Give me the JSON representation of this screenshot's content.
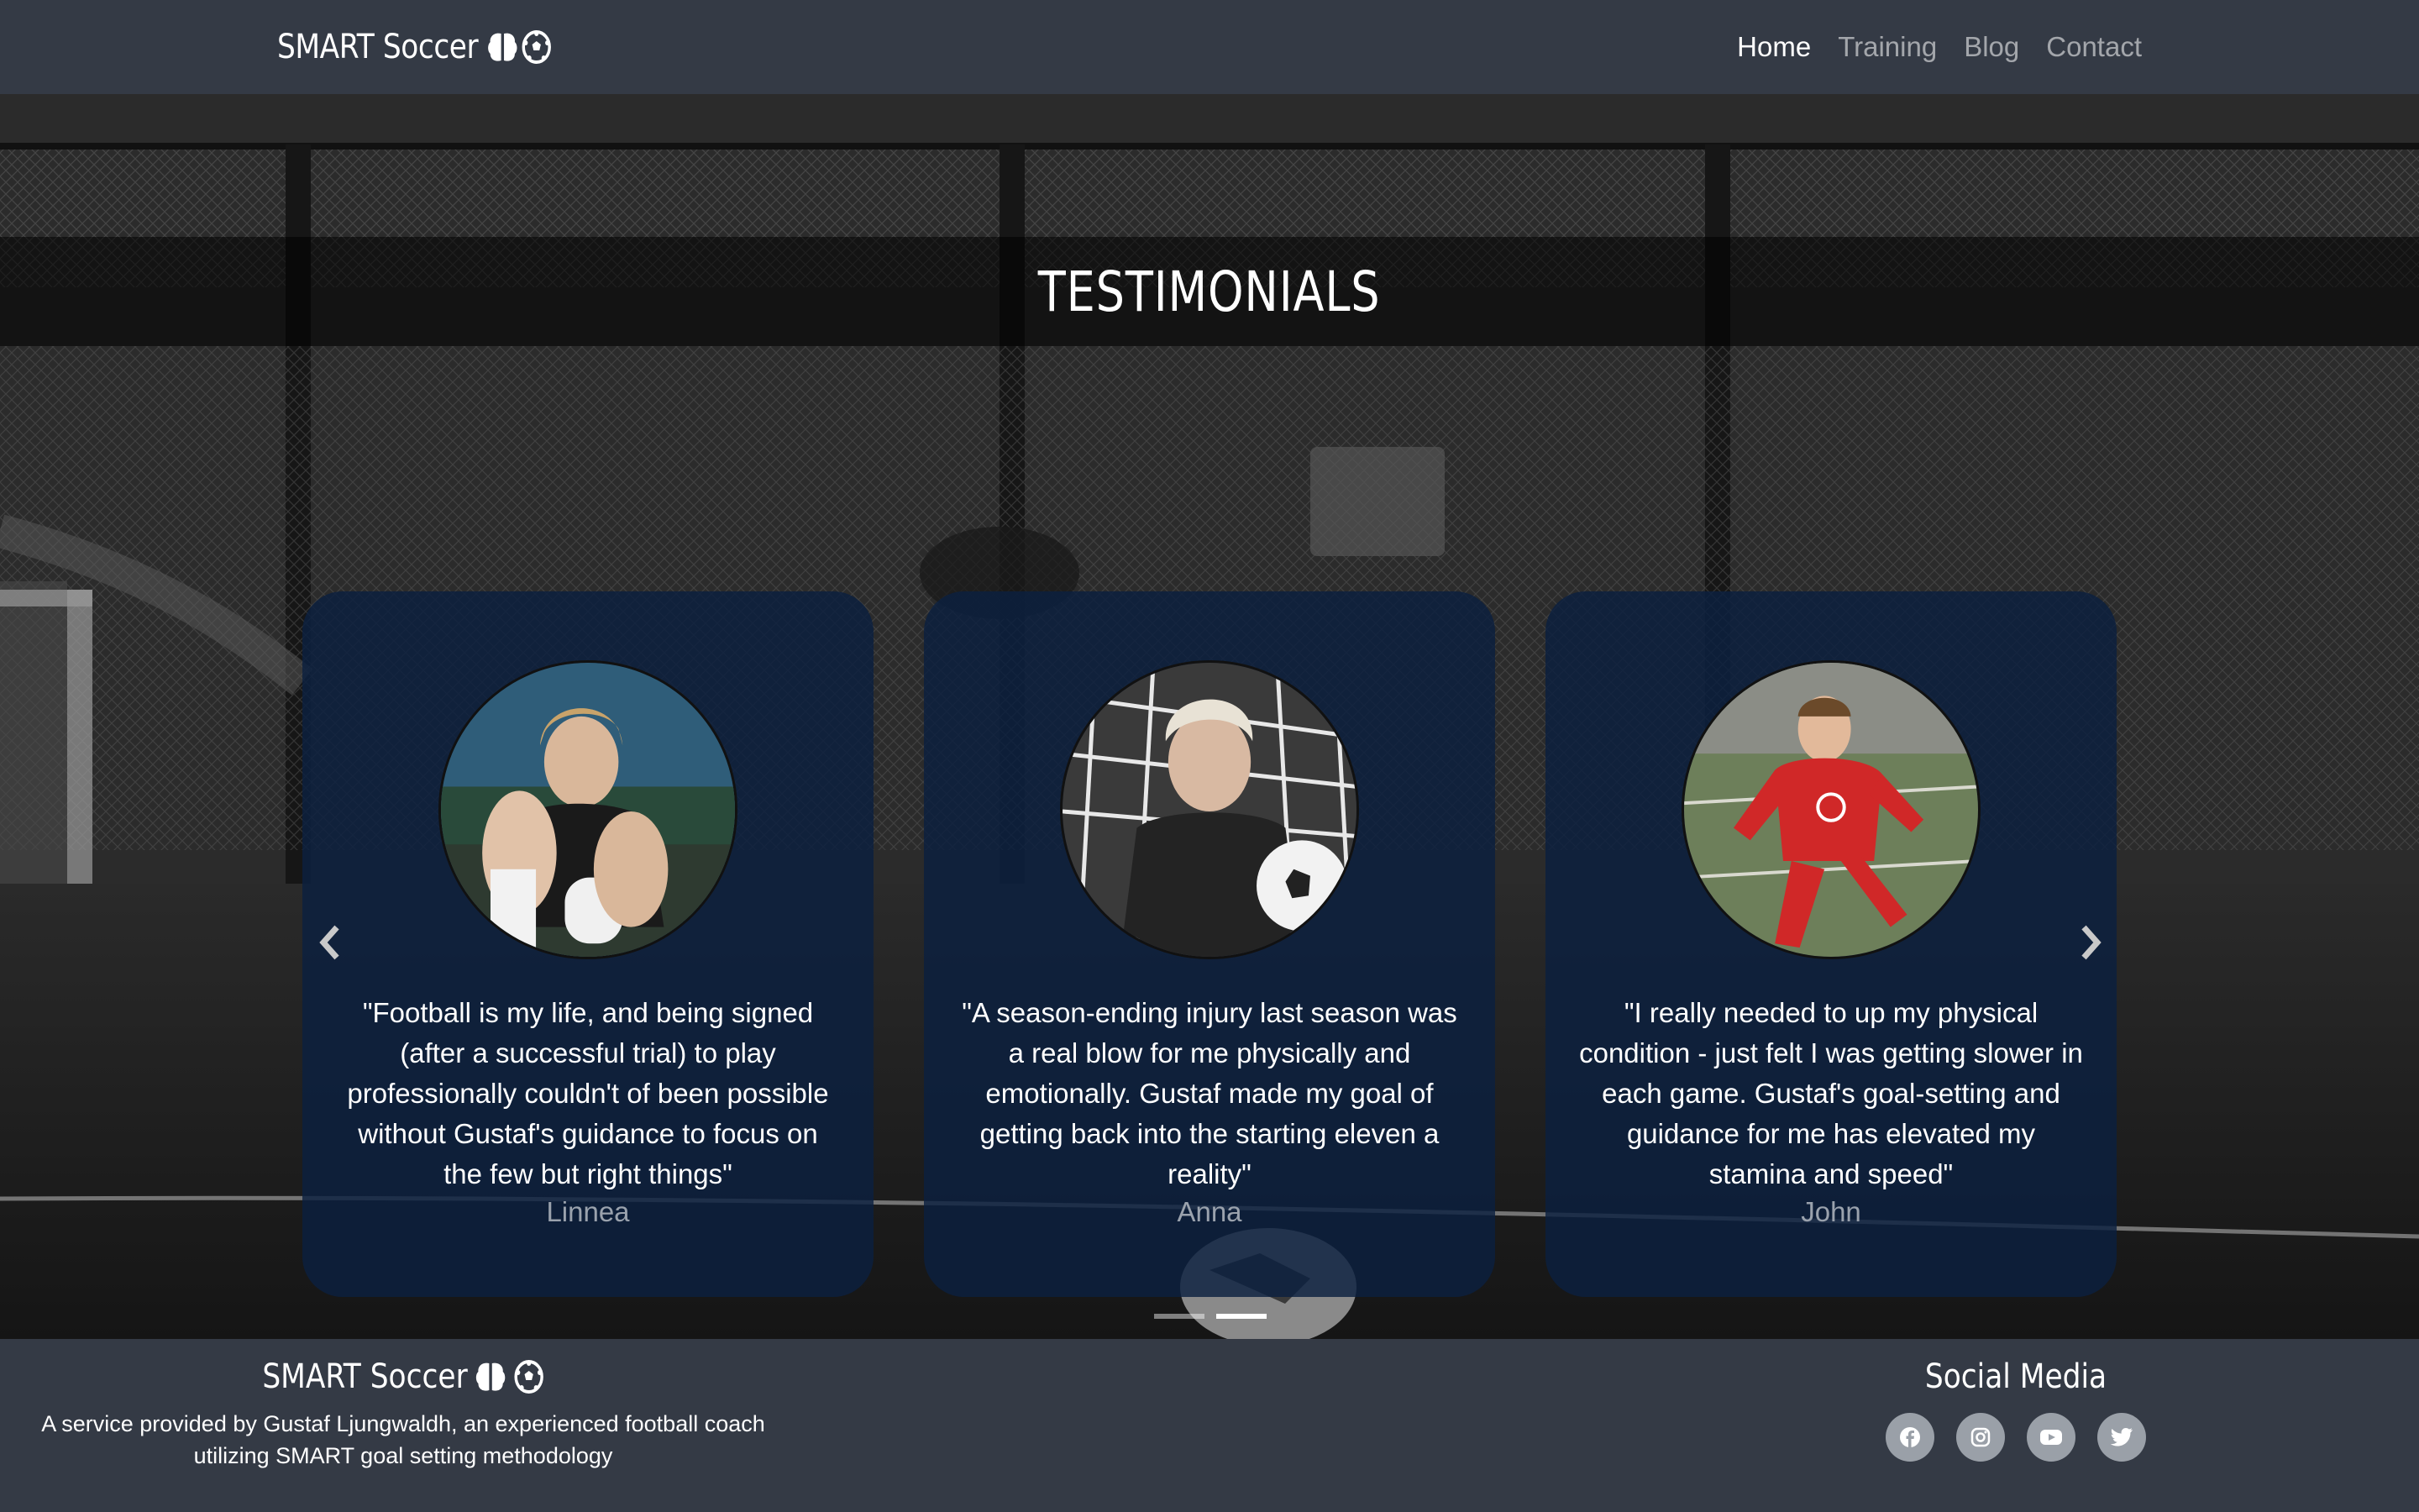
{
  "nav": {
    "brand": "SMART Soccer",
    "brand_icons": [
      "brain-icon",
      "soccer-ball-icon"
    ],
    "links": [
      {
        "label": "Home",
        "active": true
      },
      {
        "label": "Training",
        "active": false
      },
      {
        "label": "Blog",
        "active": false
      },
      {
        "label": "Contact",
        "active": false
      }
    ]
  },
  "hero": {
    "title": "TESTIMONIALS"
  },
  "testimonials": [
    {
      "quote": "\"Football is my life, and being signed (after a successful trial) to play professionally couldn't of been possible without Gustaf's guidance to focus on the few but right things\"",
      "author": "Linnea"
    },
    {
      "quote": "\"A season-ending injury last season was a real blow for me physically and emotionally. Gustaf made my goal of getting back into the starting eleven a reality\"",
      "author": "Anna"
    },
    {
      "quote": "\"I really needed to up my physical condition - just felt I was getting slower in each game. Gustaf's goal-setting and guidance for me has elevated my stamina and speed\"",
      "author": "John"
    }
  ],
  "carousel": {
    "indicator_count": 2,
    "active_indicator": 2
  },
  "footer": {
    "brand": "SMART Soccer",
    "description": "A service provided by Gustaf Ljungwaldh, an experienced football coach utilizing SMART goal setting methodology",
    "social_title": "Social Media",
    "social_icons": [
      "facebook-icon",
      "instagram-icon",
      "youtube-icon",
      "twitter-icon"
    ]
  },
  "colors": {
    "navbar_bg": "#343a45",
    "card_bg": "#0b2040",
    "author_text": "#9aa2ad",
    "social_bg": "#9aa0a8"
  }
}
